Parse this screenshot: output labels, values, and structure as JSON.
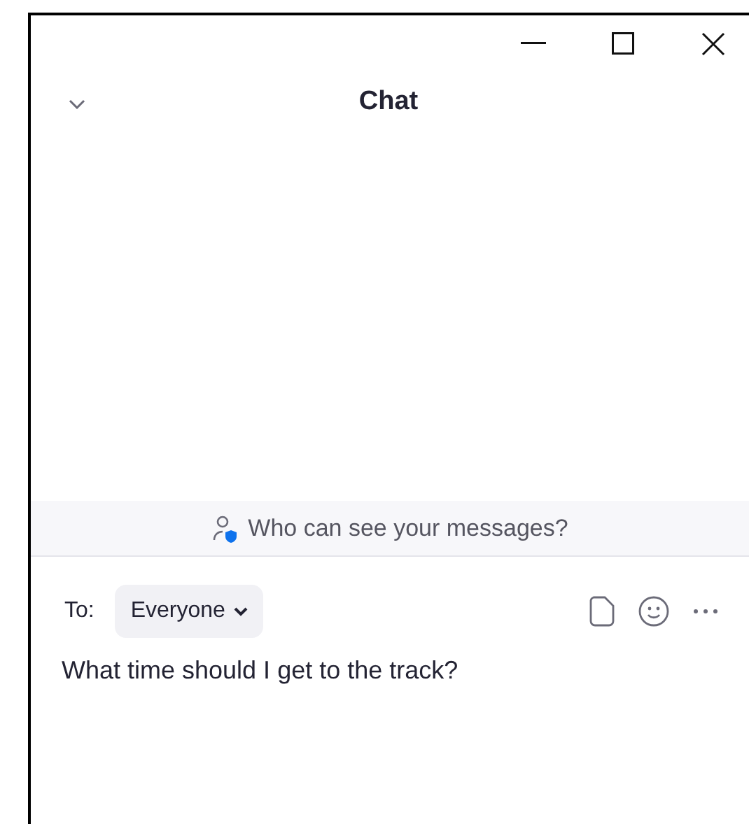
{
  "window": {
    "title": "Chat"
  },
  "privacy_banner": {
    "text": "Who can see your messages?"
  },
  "composer": {
    "to_label": "To:",
    "recipient": "Everyone",
    "message": {
      "value": "What time should I get to the track?"
    }
  }
}
